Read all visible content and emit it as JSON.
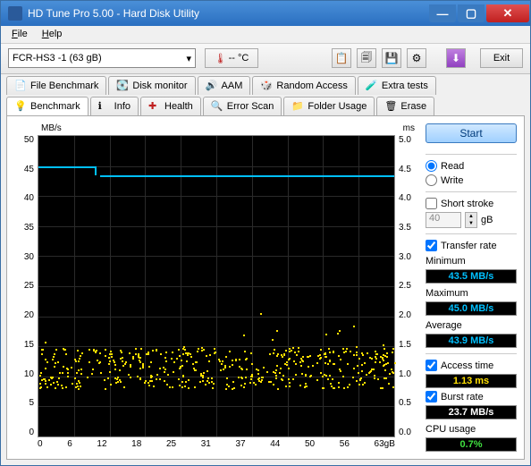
{
  "window": {
    "title": "HD Tune Pro 5.00 - Hard Disk Utility"
  },
  "menu": {
    "file": "File",
    "help": "Help"
  },
  "toolbar": {
    "drive": "FCR-HS3        -1 (63 gB)",
    "temp": "-- °C",
    "exit": "Exit"
  },
  "tabs_upper": [
    {
      "label": "File Benchmark"
    },
    {
      "label": "Disk monitor"
    },
    {
      "label": "AAM"
    },
    {
      "label": "Random Access"
    },
    {
      "label": "Extra tests"
    }
  ],
  "tabs_lower": [
    {
      "label": "Benchmark"
    },
    {
      "label": "Info"
    },
    {
      "label": "Health"
    },
    {
      "label": "Error Scan"
    },
    {
      "label": "Folder Usage"
    },
    {
      "label": "Erase"
    }
  ],
  "chart": {
    "ylabel_left": "MB/s",
    "ylabel_right": "ms",
    "xlabel_end": "63gB"
  },
  "side": {
    "start": "Start",
    "read": "Read",
    "write": "Write",
    "short_stroke": "Short stroke",
    "stroke_val": "40",
    "stroke_unit": "gB",
    "transfer_rate": "Transfer rate",
    "minimum": "Minimum",
    "min_val": "43.5 MB/s",
    "maximum": "Maximum",
    "max_val": "45.0 MB/s",
    "average": "Average",
    "avg_val": "43.9 MB/s",
    "access_time": "Access time",
    "access_val": "1.13 ms",
    "burst_rate": "Burst rate",
    "burst_val": "23.7 MB/s",
    "cpu_usage": "CPU usage",
    "cpu_val": "0.7%"
  },
  "chart_data": {
    "type": "line",
    "title": "",
    "xlabel": "gB",
    "ylabel_left": "MB/s",
    "ylabel_right": "ms",
    "xlim": [
      0,
      63
    ],
    "ylim_left": [
      0,
      50
    ],
    "ylim_right": [
      0,
      5.0
    ],
    "x_ticks": [
      0,
      6,
      12,
      18,
      25,
      31,
      37,
      44,
      50,
      56,
      63
    ],
    "y_ticks_left": [
      0,
      5,
      10,
      15,
      20,
      25,
      30,
      35,
      40,
      45,
      50
    ],
    "y_ticks_right": [
      0.0,
      0.5,
      1.0,
      1.5,
      2.0,
      2.5,
      3.0,
      3.5,
      4.0,
      4.5,
      5.0
    ],
    "series": [
      {
        "name": "Transfer rate",
        "axis": "left",
        "color": "#00c0ff",
        "x": [
          0,
          10,
          11,
          63
        ],
        "y": [
          45.0,
          45.0,
          43.5,
          43.5
        ]
      },
      {
        "name": "Access time",
        "axis": "right",
        "type": "scatter",
        "color": "#ffe000",
        "note": "dense scatter band roughly between 0.8 ms and 1.5 ms across full x-range, mean ≈ 1.13 ms"
      }
    ]
  }
}
